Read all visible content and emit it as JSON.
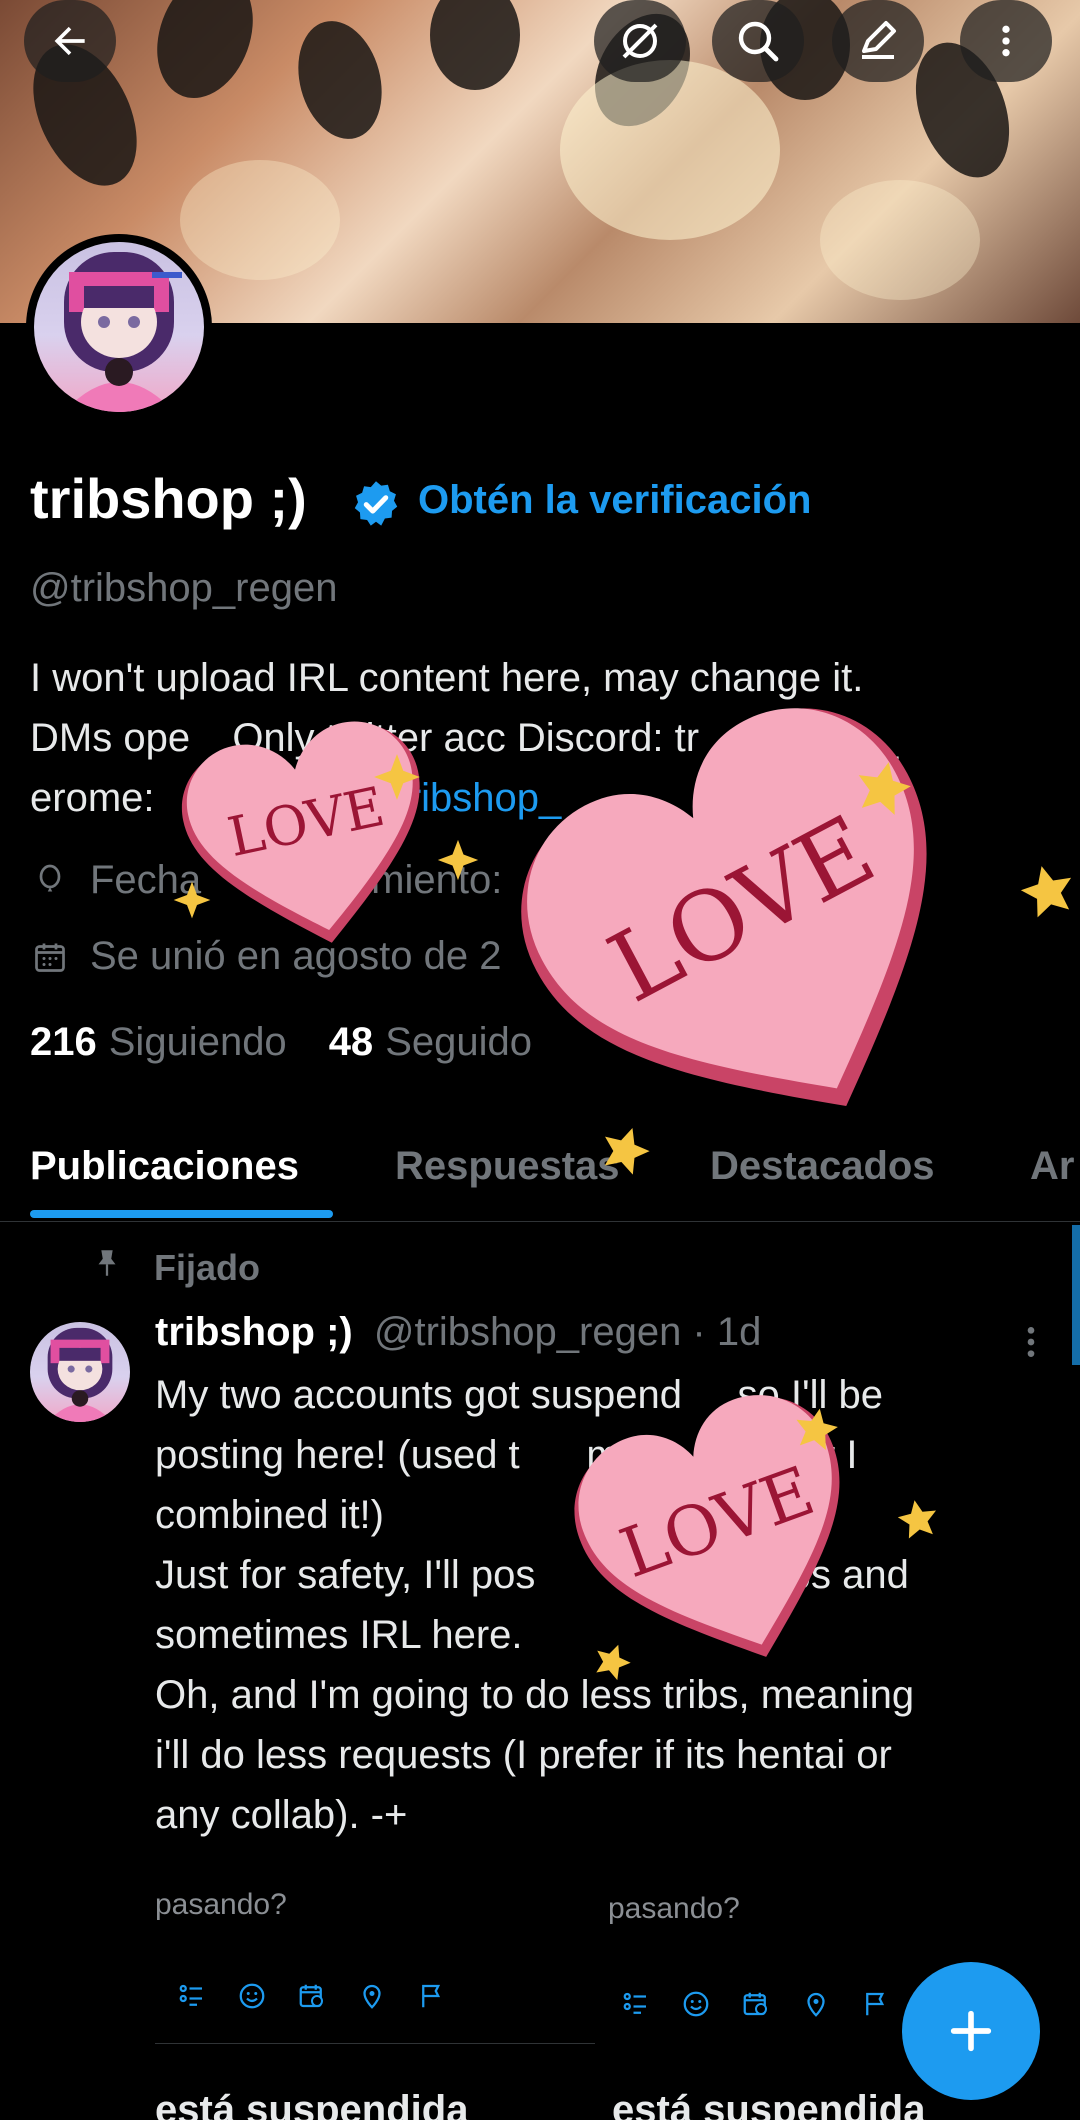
{
  "header": {
    "back_icon": "arrow-left-icon",
    "grok_icon": "grok-icon",
    "search_icon": "search-icon",
    "edit_icon": "edit-icon",
    "more_icon": "more-vertical-icon"
  },
  "profile": {
    "name": "tribshop ;)",
    "verify_link": "Obtén la verificación",
    "handle": "@tribshop_regen",
    "bio_line1": "I won't upload IRL content here, may change it.",
    "bio_line2_a": "DMs ope",
    "bio_line2_b": "Only t",
    "bio_line2_c": "witter acc Discord: tr",
    "bio_line2_d": "p__",
    "bio_line3_a": "erome: ",
    "bio_line3_link": "tribshop_",
    "birth_label": "Fecha",
    "birth_label_b": "miento:",
    "joined": "Se unió en agosto de 2",
    "following_count": "216",
    "following_label": "Siguiendo",
    "followers_count": "48",
    "followers_label": "Seguido"
  },
  "tabs": [
    {
      "label": "Publicaciones",
      "active": true
    },
    {
      "label": "Respuestas",
      "active": false
    },
    {
      "label": "Destacados",
      "active": false
    },
    {
      "label": "Ar",
      "active": false
    }
  ],
  "post": {
    "pinned_label": "Fijado",
    "author_name": "tribshop ;)",
    "author_handle": "@tribshop_regen · 1d",
    "lines": [
      "My two accounts got suspend     so I'll be",
      "posting here! (used t      my        cc but I",
      "combined it!)",
      "Just for safety, I'll pos                  l tribs and",
      "sometimes IRL here.",
      "Oh, and I'm going to do less tribs, meaning",
      "i'll do less requests (I prefer if its hentai or",
      "any collab). -+"
    ]
  },
  "composer": {
    "placeholder_left": "pasando?",
    "placeholder_right": "pasando?",
    "suspended_left": "está suspendida",
    "suspended_right": "está suspendida"
  },
  "stickers": {
    "love": "LOVE"
  },
  "colors": {
    "accent": "#1d9bf0",
    "background": "#000000",
    "heart": "#f6a9bd",
    "star": "#f5c542"
  }
}
